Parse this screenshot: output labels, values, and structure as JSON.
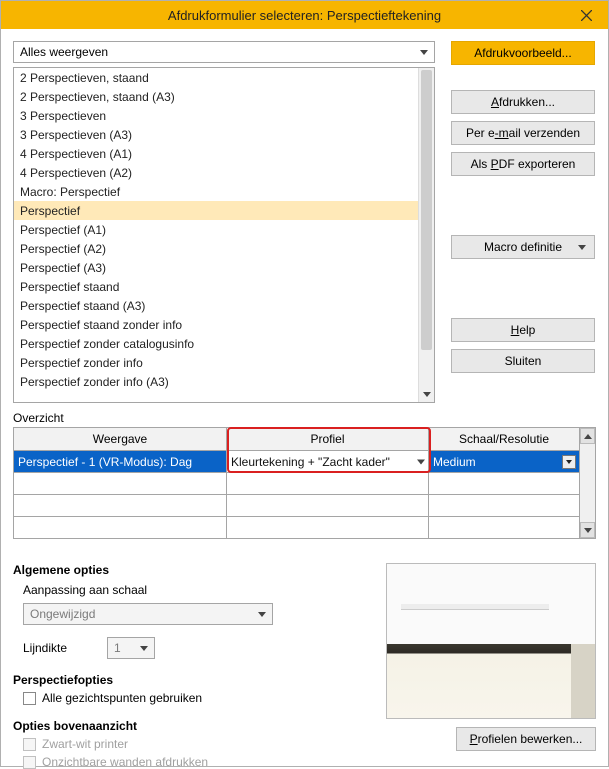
{
  "title": "Afdrukformulier selecteren: Perspectieftekening",
  "filter": {
    "value": "Alles weergeven"
  },
  "list": [
    "2 Perspectieven, staand",
    "2 Perspectieven, staand (A3)",
    "3 Perspectieven",
    "3 Perspectieven (A3)",
    "4 Perspectieven (A1)",
    "4 Perspectieven (A2)",
    "Macro: Perspectief",
    "Perspectief",
    "Perspectief (A1)",
    "Perspectief (A2)",
    "Perspectief (A3)",
    "Perspectief staand",
    "Perspectief staand (A3)",
    "Perspectief staand zonder info",
    "Perspectief zonder catalogusinfo",
    "Perspectief zonder info",
    "Perspectief zonder info (A3)"
  ],
  "selected_list_index": 7,
  "buttons": {
    "preview": "Afdrukvoorbeeld...",
    "print": "Afdrukken...",
    "email": "Per e-mail verzenden",
    "pdf": "Als PDF exporteren",
    "macro": "Macro definitie",
    "help": "Help",
    "close": "Sluiten",
    "profiles_edit": "Profielen bewerken..."
  },
  "overview": {
    "label": "Overzicht",
    "headers": {
      "col1": "Weergave",
      "col2": "Profiel",
      "col3": "Schaal/Resolutie"
    },
    "row": {
      "display": "Perspectief - 1 (VR-Modus): Dag",
      "profile": "Kleurtekening + \"Zacht kader\"",
      "scale": "Medium"
    }
  },
  "options": {
    "general_label": "Algemene opties",
    "scale_adjust_label": "Aanpassing aan schaal",
    "scale_adjust_value": "Ongewijzigd",
    "linewidth_label": "Lijndikte",
    "linewidth_value": "1",
    "persp_label": "Perspectiefopties",
    "persp_checkbox": "Alle gezichtspunten gebruiken",
    "top_label": "Opties bovenaanzicht",
    "top_bw": "Zwart-wit printer",
    "top_invis": "Onzichtbare wanden afdrukken"
  }
}
